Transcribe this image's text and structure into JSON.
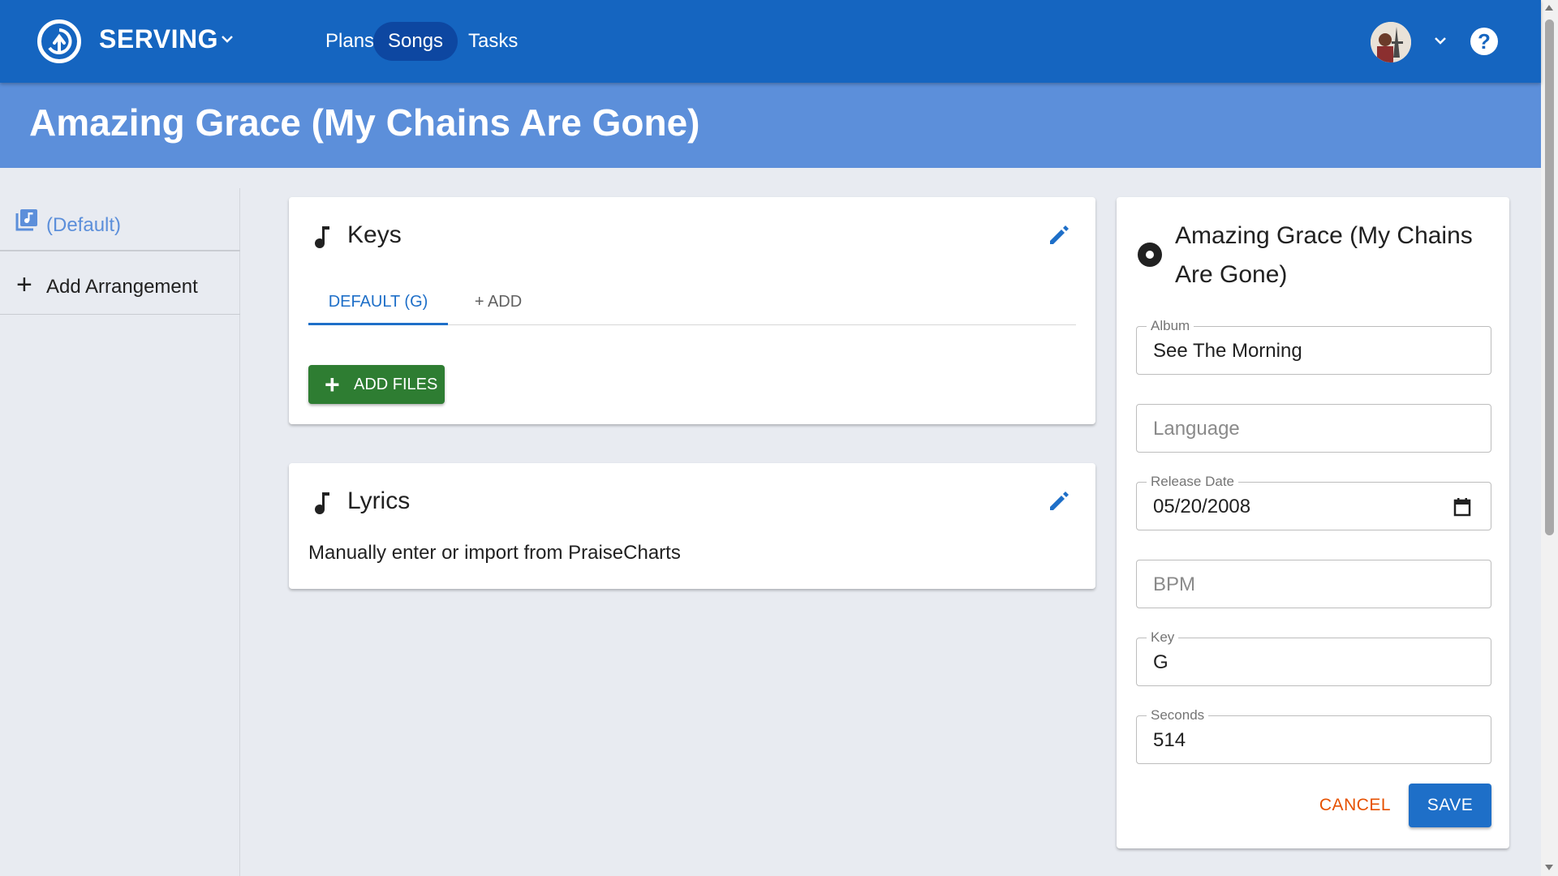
{
  "topbar": {
    "brand": "SERVING",
    "nav": [
      {
        "label": "Plans",
        "active": false
      },
      {
        "label": "Songs",
        "active": true
      },
      {
        "label": "Tasks",
        "active": false
      }
    ],
    "help_glyph": "?",
    "colors": {
      "bar": "#1565c0",
      "active_pill": "#0d47a1"
    }
  },
  "page": {
    "title": "Amazing Grace (My Chains Are Gone)"
  },
  "sidebar": {
    "items": [
      {
        "label": "(Default)",
        "icon": "library-music-icon",
        "selected": true
      },
      {
        "label": "Add Arrangement",
        "icon": "plus-icon",
        "selected": false
      }
    ]
  },
  "keys_card": {
    "title": "Keys",
    "tabs": [
      {
        "label": "DEFAULT (G)",
        "active": true
      },
      {
        "label": "+ ADD",
        "active": false
      }
    ],
    "add_files_label": "ADD FILES"
  },
  "lyrics_card": {
    "title": "Lyrics",
    "text": "Manually enter or import from PraiseCharts"
  },
  "song_card": {
    "title": "Amazing Grace (My Chains Are Gone)",
    "fields": {
      "album": {
        "label": "Album",
        "value": "See The Morning"
      },
      "language": {
        "placeholder": "Language"
      },
      "release_date": {
        "label": "Release Date",
        "value": "05/20/2008"
      },
      "bpm": {
        "placeholder": "BPM"
      },
      "key": {
        "label": "Key",
        "value": "G"
      },
      "seconds": {
        "label": "Seconds",
        "value": "514"
      }
    },
    "cancel_label": "CANCEL",
    "save_label": "SAVE"
  }
}
